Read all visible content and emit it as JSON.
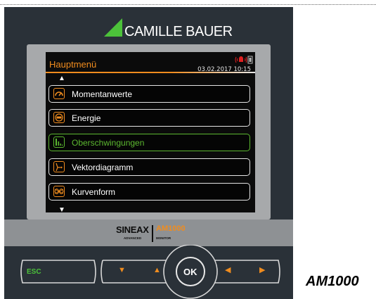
{
  "brand": {
    "name": "CAMILLE BAUER"
  },
  "screen": {
    "title": "Hauptmenü",
    "datetime": "03.02.2017  10:15",
    "scroll_up": "▲",
    "scroll_down": "▼",
    "selected_index": 2,
    "menu": [
      {
        "label": "Momentanwerte",
        "icon": "gauge-icon"
      },
      {
        "label": "Energie",
        "icon": "energy-meter-icon"
      },
      {
        "label": "Oberschwingungen",
        "icon": "harmonics-icon"
      },
      {
        "label": "Vektordiagramm",
        "icon": "vector-diagram-icon"
      },
      {
        "label": "Kurvenform",
        "icon": "waveform-icon"
      }
    ]
  },
  "product_logo": {
    "name": "SINEAX",
    "sub_left": "ADVANCED",
    "model_tag": "AM1000",
    "sub_right": "MONITOR"
  },
  "buttons": {
    "esc": "ESC",
    "down": "▼",
    "up": "▲",
    "ok": "OK",
    "left": "◀",
    "right": "▶"
  },
  "model_label": "AM1000",
  "colors": {
    "accent_orange": "#f08c1e",
    "selected_green": "#5cb830",
    "housing": "#2a3138"
  }
}
